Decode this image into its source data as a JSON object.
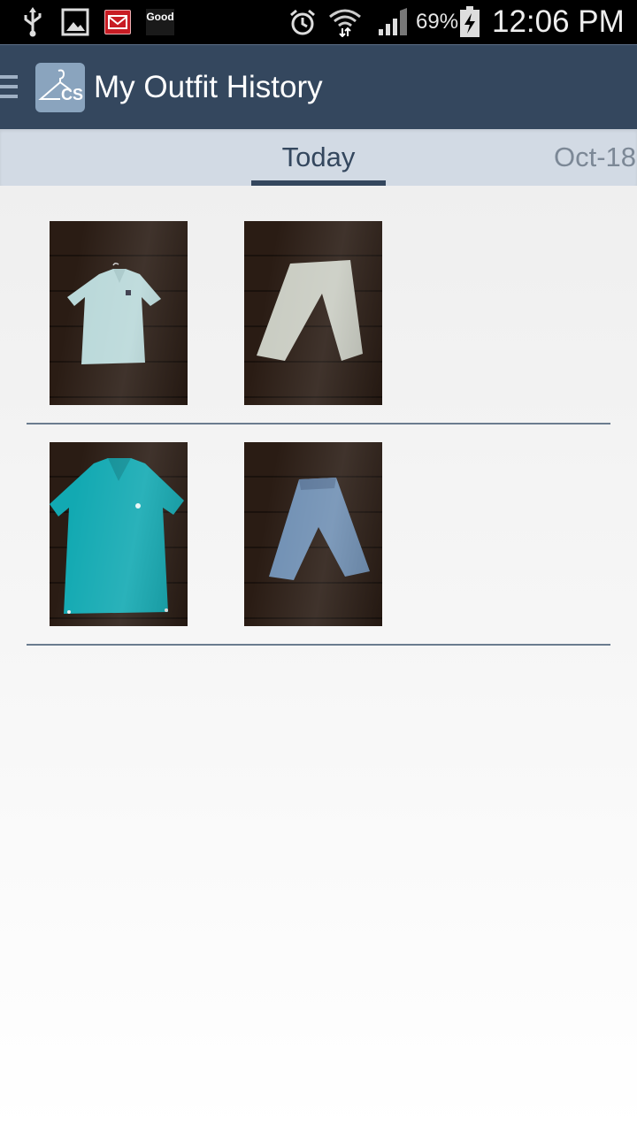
{
  "status_bar": {
    "battery_percent": "69%",
    "time": "12:06 PM",
    "good_label": "Good",
    "icons": [
      "usb-icon",
      "gallery-icon",
      "gmail-icon",
      "good-icon",
      "alarm-icon",
      "wifi-icon",
      "signal-icon",
      "battery-charging-icon"
    ]
  },
  "action_bar": {
    "title": "My Outfit History",
    "app_icon_text": "CS",
    "bg_color": "#34475e"
  },
  "tabs": [
    {
      "label": "Today",
      "selected": true
    },
    {
      "label": "Oct-18",
      "selected": false
    }
  ],
  "outfits": [
    {
      "items": [
        {
          "name": "light-polo-shirt",
          "color": "#b9d8d9"
        },
        {
          "name": "light-khaki-pants",
          "color": "#c9ccc2"
        }
      ]
    },
    {
      "items": [
        {
          "name": "teal-polo-shirt",
          "color": "#12a9b2"
        },
        {
          "name": "blue-jeans",
          "color": "#6f8fb3"
        }
      ]
    }
  ]
}
